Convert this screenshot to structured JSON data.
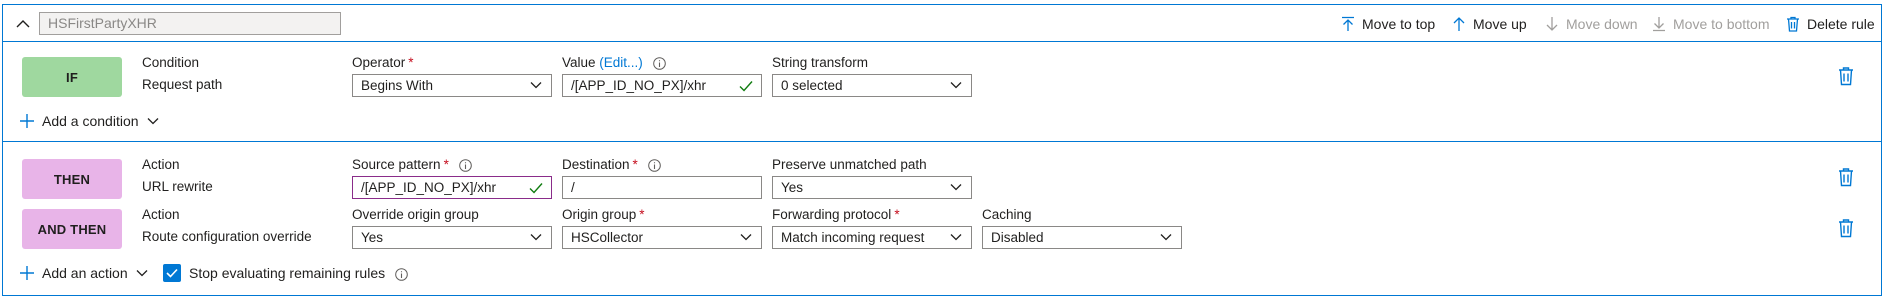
{
  "rule": {
    "name_value": "HSFirstPartyXHR",
    "toolbar": {
      "move_to_top": "Move to top",
      "move_up": "Move up",
      "move_down": "Move down",
      "move_to_bottom": "Move to bottom",
      "delete_rule": "Delete rule"
    }
  },
  "condition_section": {
    "badge": "IF",
    "type_label": "Condition",
    "type_value": "Request path",
    "operator_label": "Operator",
    "operator_value": "Begins With",
    "value_label": "Value",
    "value_edit": "(Edit...)",
    "value_value": "/[APP_ID_NO_PX]/xhr",
    "transform_label": "String transform",
    "transform_value": "0 selected",
    "add_condition": "Add a condition"
  },
  "action_section": {
    "then": {
      "badge": "THEN",
      "type_label": "Action",
      "type_value": "URL rewrite",
      "source_label": "Source pattern",
      "source_value": "/[APP_ID_NO_PX]/xhr",
      "destination_label": "Destination",
      "destination_value": "/",
      "preserve_label": "Preserve unmatched path",
      "preserve_value": "Yes"
    },
    "and_then": {
      "badge": "AND THEN",
      "type_label": "Action",
      "type_value": "Route configuration override",
      "override_label": "Override origin group",
      "override_value": "Yes",
      "origin_label": "Origin group",
      "origin_value": "HSCollector",
      "protocol_label": "Forwarding protocol",
      "protocol_value": "Match incoming request",
      "caching_label": "Caching",
      "caching_value": "Disabled"
    },
    "add_action": "Add an action",
    "stop_label": "Stop evaluating remaining rules",
    "stop_checked": true
  },
  "colors": {
    "accent": "#0078d4",
    "if_badge": "#9fd89f",
    "then_badge": "#e8b4e8",
    "required": "#c50f1f",
    "valid_check": "#107c10"
  },
  "icons": [
    "chevron-up-icon",
    "arrow-to-top-icon",
    "arrow-up-icon",
    "arrow-down-icon",
    "arrow-to-bottom-icon",
    "trash-icon",
    "plus-icon",
    "chevron-down-icon",
    "info-icon",
    "checkmark-icon"
  ]
}
